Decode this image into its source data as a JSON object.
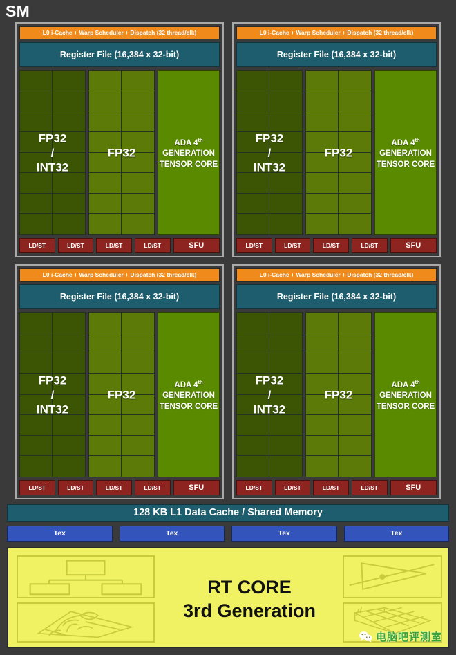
{
  "title": "SM",
  "colors": {
    "background": "#3a3a3a",
    "block_border": "#a9a9a9",
    "scheduler": "#f08a1a",
    "register_file": "#1d5d6e",
    "fp32_int32": "#3b5505",
    "fp32": "#5b7a08",
    "tensor_core": "#5a8a00",
    "ldst": "#8e2420",
    "tex": "#3355bb",
    "rt_core": "#f0f264",
    "watermark": "#3aa33a"
  },
  "processing_blocks": [
    {
      "scheduler": "L0 i-Cache + Warp Scheduler + Dispatch (32 thread/clk)",
      "register_file": "Register File (16,384 x 32-bit)",
      "core_group_int": "FP32 / INT32",
      "core_group_int_line1": "FP32",
      "core_group_int_line2": "/",
      "core_group_int_line3": "INT32",
      "core_group_fp": "FP32",
      "tensor_line1": "ADA 4",
      "tensor_sup": "th",
      "tensor_line2": "GENERATION",
      "tensor_line3": "TENSOR CORE",
      "ldst": [
        "LD/ST",
        "LD/ST",
        "LD/ST",
        "LD/ST"
      ],
      "sfu": "SFU"
    },
    {
      "scheduler": "L0 i-Cache + Warp Scheduler + Dispatch (32 thread/clk)",
      "register_file": "Register File (16,384 x 32-bit)",
      "core_group_int": "FP32 / INT32",
      "core_group_int_line1": "FP32",
      "core_group_int_line2": "/",
      "core_group_int_line3": "INT32",
      "core_group_fp": "FP32",
      "tensor_line1": "ADA 4",
      "tensor_sup": "th",
      "tensor_line2": "GENERATION",
      "tensor_line3": "TENSOR CORE",
      "ldst": [
        "LD/ST",
        "LD/ST",
        "LD/ST",
        "LD/ST"
      ],
      "sfu": "SFU"
    },
    {
      "scheduler": "L0 i-Cache + Warp Scheduler + Dispatch (32 thread/clk)",
      "register_file": "Register File (16,384 x 32-bit)",
      "core_group_int": "FP32 / INT32",
      "core_group_int_line1": "FP32",
      "core_group_int_line2": "/",
      "core_group_int_line3": "INT32",
      "core_group_fp": "FP32",
      "tensor_line1": "ADA 4",
      "tensor_sup": "th",
      "tensor_line2": "GENERATION",
      "tensor_line3": "TENSOR CORE",
      "ldst": [
        "LD/ST",
        "LD/ST",
        "LD/ST",
        "LD/ST"
      ],
      "sfu": "SFU"
    },
    {
      "scheduler": "L0 i-Cache + Warp Scheduler + Dispatch (32 thread/clk)",
      "register_file": "Register File (16,384 x 32-bit)",
      "core_group_int": "FP32 / INT32",
      "core_group_int_line1": "FP32",
      "core_group_int_line2": "/",
      "core_group_int_line3": "INT32",
      "core_group_fp": "FP32",
      "tensor_line1": "ADA 4",
      "tensor_sup": "th",
      "tensor_line2": "GENERATION",
      "tensor_line3": "TENSOR CORE",
      "ldst": [
        "LD/ST",
        "LD/ST",
        "LD/ST",
        "LD/ST"
      ],
      "sfu": "SFU"
    }
  ],
  "l1_cache": "128 KB L1 Data Cache / Shared Memory",
  "tex_units": [
    "Tex",
    "Tex",
    "Tex",
    "Tex"
  ],
  "rt_core": {
    "line1": "RT CORE",
    "line2": "3rd Generation",
    "illustrations": [
      "bvh-tree-icon",
      "foliage-icon",
      "ray-triangle-intersection-icon",
      "wireframe-mesh-icon"
    ]
  },
  "watermark": {
    "text": "电脑吧评测室",
    "icon": "wechat-icon"
  }
}
